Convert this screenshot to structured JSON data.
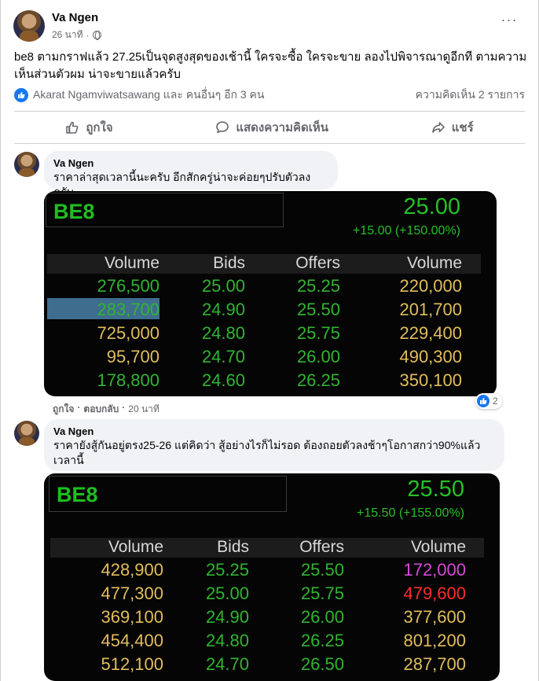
{
  "post": {
    "author": "Va Ngen",
    "time": "26 นาที",
    "more": "···",
    "text": "be8 ตามกราฟแล้ว 27.25เป็นจุดสูงสุดของเช้านี้ ใครจะซื้อ ใครจะขาย ลองไปพิจารณาดูอีกที ตามความเห็นส่วนตัวผม น่าจะขายแล้วครับ",
    "reactions_text": "Akarat Ngamviwatsawang และ คนอื่นๆ อีก 3 คน",
    "comment_count": "ความคิดเห็น 2 รายการ",
    "actions": {
      "like": "ถูกใจ",
      "comment": "แสดงความคิดเห็น",
      "share": "แชร์"
    }
  },
  "comments": [
    {
      "author": "Va Ngen",
      "text": "ราคาล่าสุดเวลานี้นะครับ อีกสักครู่น่าจะค่อยๆปรับตัวลงครับ",
      "like_label": "ถูกใจ",
      "reply_label": "ตอบกลับ",
      "time": "20 นาที",
      "reaction_count": "2",
      "quote": {
        "symbol": "BE8",
        "price": "25.00",
        "change": "+15.00 (+150.00%)",
        "headers": [
          "Volume",
          "Bids",
          "Offers",
          "Volume"
        ],
        "rows": [
          [
            "276,500",
            "25.00",
            "25.25",
            "220,000"
          ],
          [
            "283,700",
            "24.90",
            "25.50",
            "201,700"
          ],
          [
            "725,000",
            "24.80",
            "25.75",
            "229,400"
          ],
          [
            "95,700",
            "24.70",
            "26.00",
            "490,300"
          ],
          [
            "178,800",
            "24.60",
            "26.25",
            "350,100"
          ]
        ]
      }
    },
    {
      "author": "Va Ngen",
      "text": "ราคายังสู้กันอยู่ตรง25-26 แต่คิดว่า สู้อย่างไรก็ไม่รอด ต้องถอยตัวลงช้าๆโอกาสกว่า90%แล้วเวลานี้",
      "quote": {
        "symbol": "BE8",
        "price": "25.50",
        "change": "+15.50 (+155.00%)",
        "headers": [
          "Volume",
          "Bids",
          "Offers",
          "Volume"
        ],
        "rows": [
          [
            "428,900",
            "25.25",
            "25.50",
            "172,000"
          ],
          [
            "477,300",
            "25.00",
            "25.75",
            "479,600"
          ],
          [
            "369,100",
            "24.90",
            "26.00",
            "377,600"
          ],
          [
            "454,400",
            "24.80",
            "26.25",
            "801,200"
          ],
          [
            "512,100",
            "24.70",
            "26.50",
            "287,700"
          ]
        ]
      }
    }
  ],
  "colors": {
    "accent": "#1877f2",
    "quote_green": "#31b431",
    "quote_yellow": "#e2bd5c",
    "quote_magenta": "#d34ad6",
    "quote_red": "#ff2b2b"
  }
}
